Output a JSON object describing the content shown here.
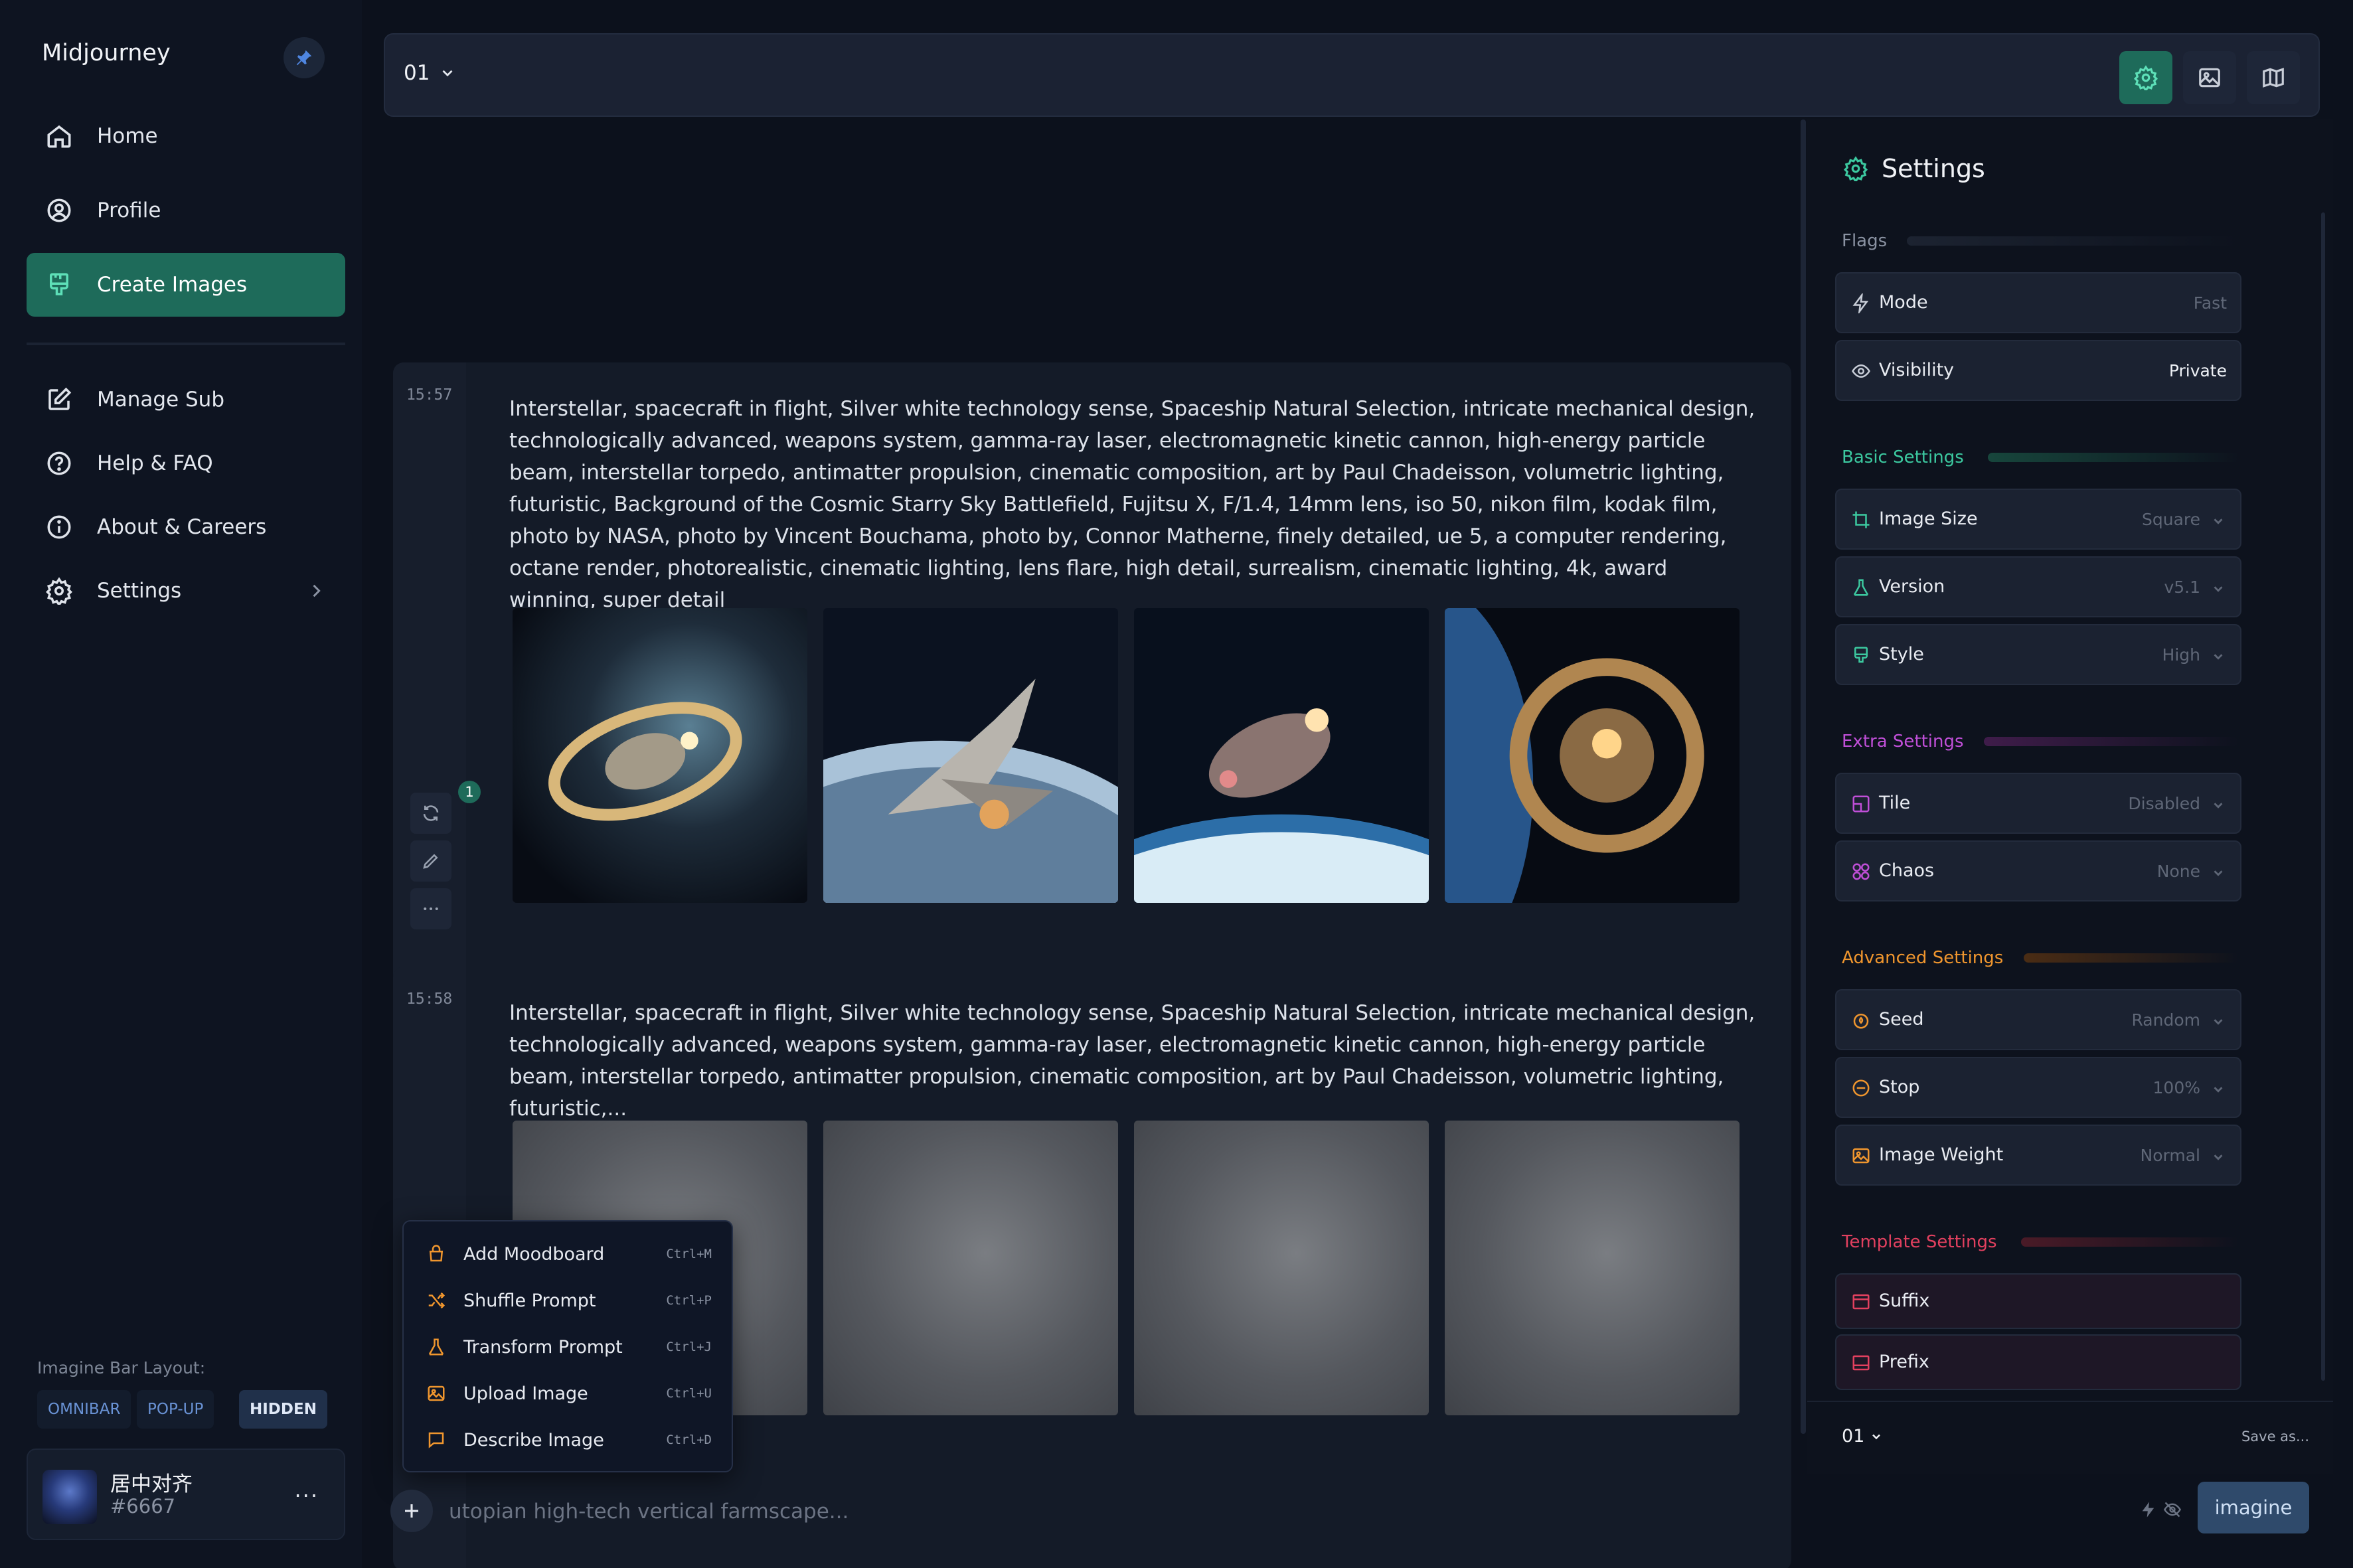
{
  "app": {
    "brand": "Midjourney"
  },
  "sidebar": {
    "items": [
      {
        "label": "Home",
        "icon": "home-icon"
      },
      {
        "label": "Profile",
        "icon": "profile-icon"
      },
      {
        "label": "Create Images",
        "icon": "brush-icon",
        "active": true
      },
      {
        "label": "Manage Sub",
        "icon": "edit-icon"
      },
      {
        "label": "Help & FAQ",
        "icon": "help-icon"
      },
      {
        "label": "About & Careers",
        "icon": "info-icon"
      },
      {
        "label": "Settings",
        "icon": "gear-icon"
      }
    ],
    "layout_label": "Imagine Bar Layout:",
    "layout_options": [
      "OMNIBAR",
      "POP-UP",
      "HIDDEN"
    ],
    "layout_selected": "HIDDEN",
    "user": {
      "name": "居中对齐",
      "tag": "#6667",
      "more": "···"
    }
  },
  "topbar": {
    "tab": "01"
  },
  "jobs": [
    {
      "time": "15:57",
      "prompt": "Interstellar, spacecraft in flight, Silver white technology sense, Spaceship Natural Selection, intricate mechanical design, technologically advanced, weapons system, gamma-ray laser, electromagnetic kinetic cannon, high-energy particle beam, interstellar torpedo, antimatter propulsion, cinematic composition, art by Paul Chadeisson, volumetric lighting, futuristic, Background of the Cosmic Starry Sky Battlefield, Fujitsu X, F/1.4, 14mm lens, iso 50, nikon film, kodak film, photo by NASA, photo by Vincent Bouchama, photo by, Connor Matherne, finely detailed, ue 5, a computer rendering, octane render, photorealistic, cinematic lighting, lens flare, high detail, surrealism, cinematic lighting, 4k, award winning, super detail",
      "badge": "1"
    },
    {
      "time": "15:58",
      "prompt": "Interstellar, spacecraft in flight, Silver white technology sense, Spaceship Natural Selection, intricate mechanical design, technologically advanced, weapons system, gamma-ray laser, electromagnetic kinetic cannon, high-energy particle beam, interstellar torpedo, antimatter propulsion, cinematic composition, art by Paul Chadeisson, volumetric lighting, futuristic,..."
    }
  ],
  "context_menu": [
    {
      "label": "Add Moodboard",
      "shortcut": "Ctrl+M"
    },
    {
      "label": "Shuffle Prompt",
      "shortcut": "Ctrl+P"
    },
    {
      "label": "Transform Prompt",
      "shortcut": "Ctrl+J"
    },
    {
      "label": "Upload Image",
      "shortcut": "Ctrl+U"
    },
    {
      "label": "Describe Image",
      "shortcut": "Ctrl+D"
    }
  ],
  "prompt_bar": {
    "placeholder": "utopian high-tech vertical farmscape...",
    "submit": "imagine"
  },
  "settings": {
    "title": "Settings",
    "sections": {
      "flags": "Flags",
      "basic": "Basic Settings",
      "extra": "Extra Settings",
      "advanced": "Advanced Settings",
      "template": "Template Settings"
    },
    "rows": {
      "mode": {
        "label": "Mode",
        "value": "Fast"
      },
      "visibility": {
        "label": "Visibility",
        "value": "Private"
      },
      "image_size": {
        "label": "Image Size",
        "value": "Square"
      },
      "version": {
        "label": "Version",
        "value": "v5.1"
      },
      "style": {
        "label": "Style",
        "value": "High"
      },
      "tile": {
        "label": "Tile",
        "value": "Disabled"
      },
      "chaos": {
        "label": "Chaos",
        "value": "None"
      },
      "seed": {
        "label": "Seed",
        "value": "Random"
      },
      "stop": {
        "label": "Stop",
        "value": "100%"
      },
      "image_weight": {
        "label": "Image Weight",
        "value": "Normal"
      },
      "suffix": {
        "label": "Suffix"
      },
      "prefix": {
        "label": "Prefix"
      }
    },
    "footer": {
      "preset": "01",
      "save": "Save as..."
    }
  },
  "colors": {
    "accent": "#1e6b5a",
    "basic": "#3cc9a0",
    "extra": "#c04fd8",
    "advanced": "#f0962e",
    "template": "#e2405f"
  }
}
